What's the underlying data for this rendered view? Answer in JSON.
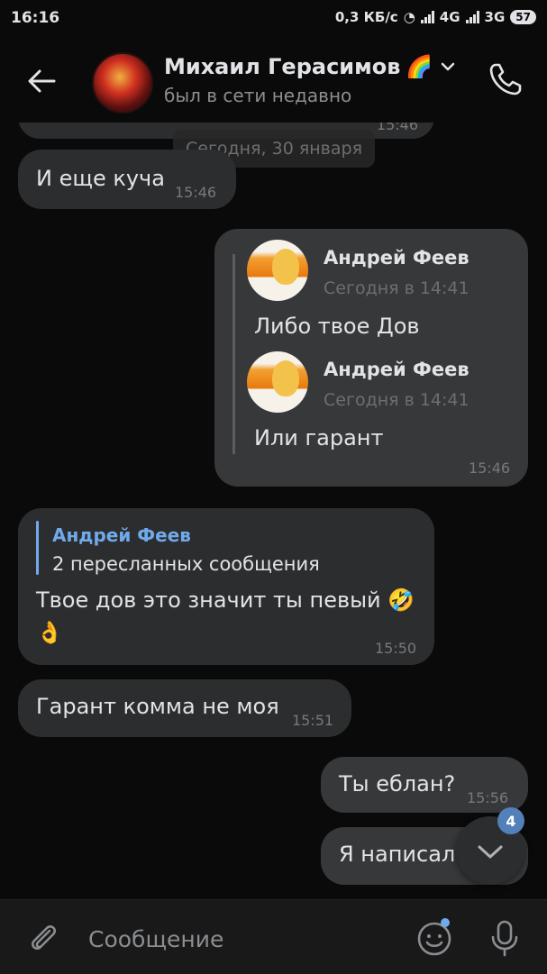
{
  "status_bar": {
    "time": "16:16",
    "speed": "0,3 КБ/с",
    "net1": "4G",
    "net2": "3G",
    "battery": "57"
  },
  "header": {
    "contact_name": "Михаил Герасимов",
    "name_emoji": "🌈",
    "status": "был в сети недавно",
    "icons": [
      "back-arrow-icon",
      "chevron-down-icon",
      "phone-icon"
    ]
  },
  "chat": {
    "partial_time": "15:46",
    "date_separator": "Сегодня, 30 января",
    "messages": [
      {
        "text": "И еще куча",
        "time": "15:46"
      },
      {
        "forwarded": [
          {
            "author": "Андрей Феев",
            "date": "Сегодня в 14:41",
            "text": "Либо твое Дов"
          },
          {
            "author": "Андрей Феев",
            "date": "Сегодня в 14:41",
            "text": "Или гарант"
          }
        ],
        "time": "15:46"
      },
      {
        "reply_author": "Андрей Феев",
        "reply_text": "2 пересланных сообщения",
        "text_line1": "Твое дов это значит ты певый",
        "emoji1": "🤣",
        "emoji2": "👌",
        "time": "15:50"
      },
      {
        "text": "Гарант комма не моя",
        "time": "15:51"
      },
      {
        "text": "Ты еблан?",
        "time": "15:56"
      },
      {
        "text": "Я написал",
        "time": ""
      }
    ]
  },
  "scroll_fab": {
    "badge": "4"
  },
  "composer": {
    "placeholder": "Сообщение"
  },
  "colors": {
    "background": "#0a0a0a",
    "bubble_in": "#2c2d2e",
    "bubble_out": "#373839",
    "accent": "#71aaeb",
    "badge": "#5181b8"
  }
}
